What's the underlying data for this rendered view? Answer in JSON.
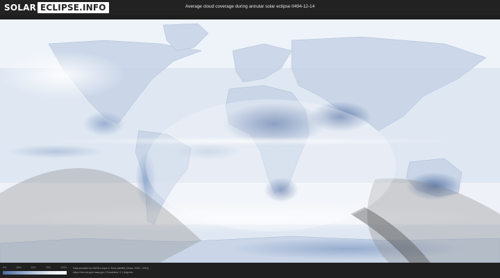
{
  "header": {
    "logo_part1": "SOLAR",
    "logo_part2": "ECLIPSE.INFO",
    "title": "Average cloud coverage during annular solar eclipse 0494-12-14"
  },
  "legend": {
    "ticks": [
      "0%",
      "25%",
      "50%",
      "75%",
      "100%"
    ],
    "colors": [
      "#4a6a9c",
      "#7f99bf",
      "#b6c7de",
      "#e7edf5",
      "#ffffff"
    ]
  },
  "footer": {
    "credit_line1": "Data provided by NASA's Aqua & Terra satellite (Years: 2000 - 2019)",
    "credit_line2": "https://neo.sci.gsfc.nasa.gov  |  Resolution: 0.1 degrees"
  },
  "map": {
    "ocean_color": "#e3eaf3",
    "cloud_color": "#ffffff",
    "clear_sky_color": "#6e87b3",
    "shadow_color": "#8c8c8c"
  }
}
